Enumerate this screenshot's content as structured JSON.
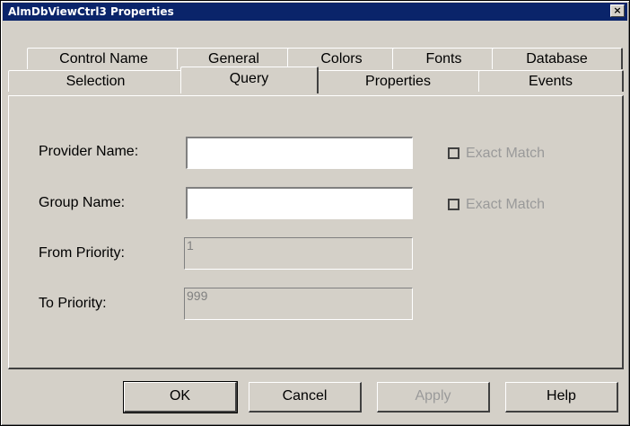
{
  "window": {
    "title": "AlmDbViewCtrl3 Properties",
    "close_glyph": "×"
  },
  "tabs": {
    "row1": [
      "Control Name",
      "General",
      "Colors",
      "Fonts",
      "Database"
    ],
    "row2": [
      "Selection",
      "Query",
      "Properties",
      "Events"
    ],
    "active": "Query"
  },
  "form": {
    "provider_label": "Provider Name:",
    "provider_value": "",
    "provider_exact_match": "Exact Match",
    "group_label": "Group Name:",
    "group_value": "",
    "group_exact_match": "Exact Match",
    "from_priority_label": "From Priority:",
    "from_priority_value": "1",
    "to_priority_label": "To Priority:",
    "to_priority_value": "999"
  },
  "buttons": {
    "ok": "OK",
    "cancel": "Cancel",
    "apply": "Apply",
    "help": "Help"
  },
  "colors": {
    "titlebar": "#0a246a",
    "face": "#d4d0c8",
    "disabled_text": "#9a9a9a"
  }
}
